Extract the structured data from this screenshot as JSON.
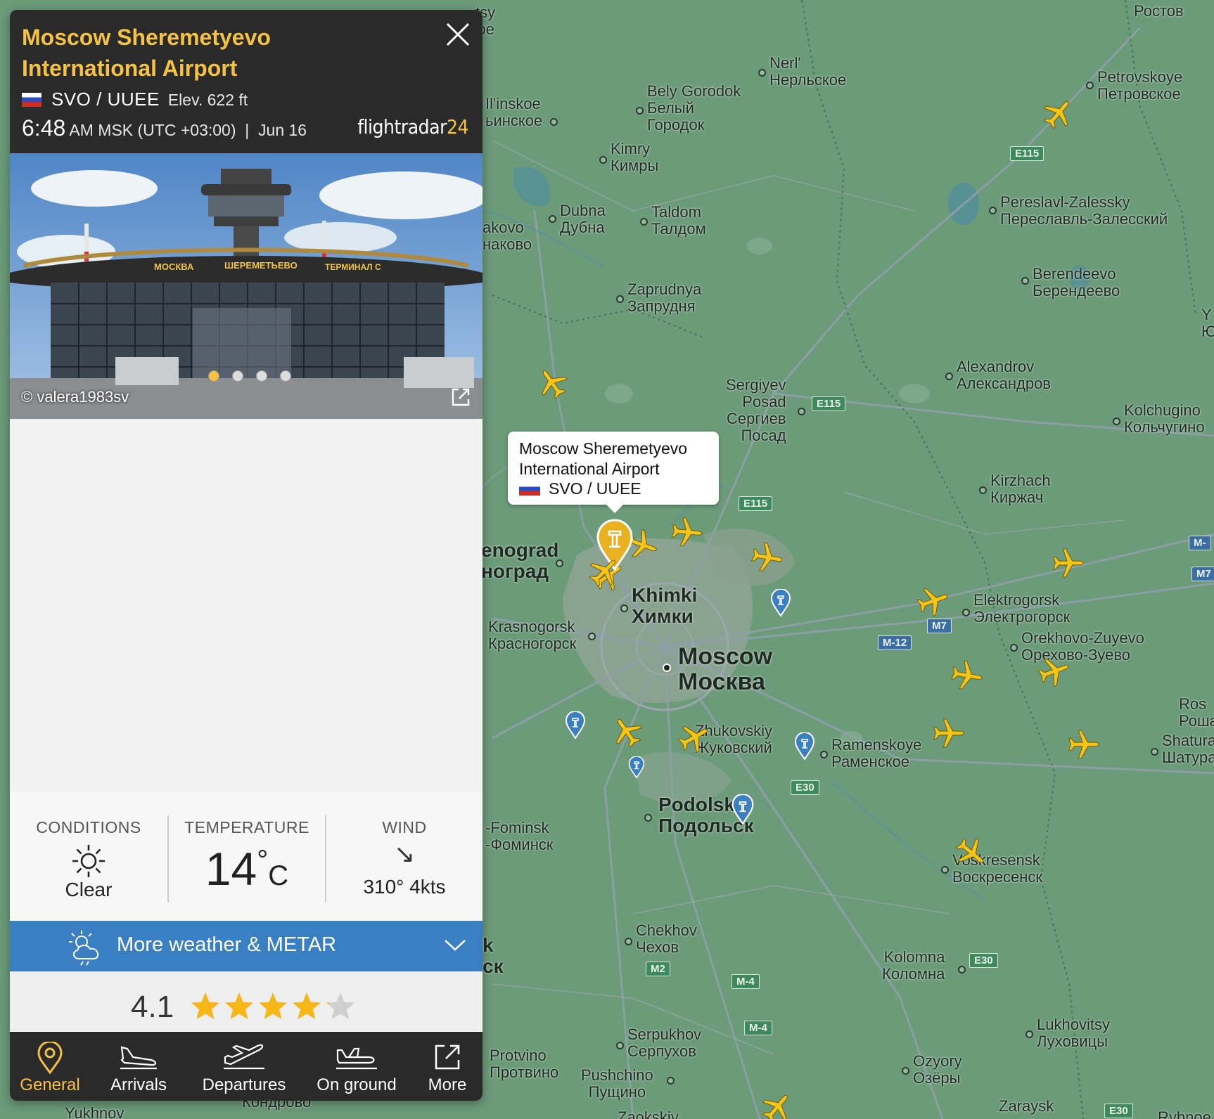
{
  "airport": {
    "name_line1": "Moscow Sheremetyevo",
    "name_line2": "International Airport",
    "codes": "SVO / UUEE",
    "elevation": "Elev. 622 ft",
    "time": "6:48",
    "time_suffix": "AM MSK (UTC +03:00)  |  Jun 16",
    "brand_main": "flightradar",
    "brand_num": "24"
  },
  "photo": {
    "credit": "© valera1983sv",
    "sign_left": "МОСКВА",
    "sign_mid": "ШЕРЕМЕТЬЕВО",
    "sign_right": "ТЕРМИНАЛ С",
    "slide_count": 4,
    "active_slide": 1
  },
  "weather": {
    "conditions_label": "CONDITIONS",
    "conditions_value": "Clear",
    "temperature_label": "TEMPERATURE",
    "temperature_value": "14",
    "temperature_deg": "°",
    "temperature_unit": "C",
    "wind_label": "WIND",
    "wind_arrow": "↘",
    "wind_value": "310° 4kts",
    "more_label": "More weather & METAR"
  },
  "rating": {
    "value": "4.1",
    "stars": 4.1,
    "max": 5
  },
  "nav": {
    "general": "General",
    "arrivals": "Arrivals",
    "departures": "Departures",
    "on_ground": "On ground",
    "more": "More"
  },
  "callout": {
    "line1": "Moscow Sheremetyevo",
    "line2": "International Airport",
    "codes": "SVO / UUEE"
  },
  "cities": {
    "rostov": "Ростов",
    "nerl_en": "Nerl'",
    "nerl_ru": "Нерльское",
    "petrovskoye_en": "Petrovskoye",
    "petrovskoye_ru": "Петровское",
    "bely_en1": "Bely Gorodok",
    "bely_ru1": "Белый",
    "bely_ru2": "Городок",
    "ilinskoe_en": "Il'inskoe",
    "ilinskoe_ru": "ьинское",
    "kimry_en": "Kimry",
    "kimry_ru": "Кимры",
    "dubna_en": "Dubna",
    "dubna_ru": "Дубна",
    "taldom_en": "Taldom",
    "taldom_ru": "Талдом",
    "pereslavl_en": "Pereslavl-Zalessky",
    "pereslavl_ru": "Переславль-Залесский",
    "nakovo_en": "akovo",
    "nakovo_ru": "наково",
    "berendeevo_en": "Berendeevo",
    "berendeevo_ru": "Берендеево",
    "zaprudnya_en": "Zaprudnya",
    "zaprudnya_ru": "Запрудня",
    "alexandrov_en": "Alexandrov",
    "alexandrov_ru": "Александров",
    "sergiyev_en1": "Sergiyev",
    "sergiyev_en2": "Posad",
    "sergiyev_ru1": "Сергиев",
    "sergiyev_ru2": "Посад",
    "kolchugino_en": "Kolchugino",
    "kolchugino_ru": "Кольчугино",
    "kirzhach_en": "Kirzhach",
    "kirzhach_ru": "Киржач",
    "zelenograd_en": "enograd",
    "zelenograd_ru": "ноград",
    "khimki_en": "Khimki",
    "khimki_ru": "Химки",
    "elektrogorsk_en": "Elektrogorsk",
    "elektrogorsk_ru": "Электрогорск",
    "krasnogorsk_en": "Krasnogorsk",
    "krasnogorsk_ru": "Красногорск",
    "orekhovo_en": "Orekhovo-Zuyevo",
    "orekhovo_ru": "Орехово-Зуево",
    "moscow_en": "Moscow",
    "moscow_ru": "Москва",
    "zhukovskiy_en": "Zhukovskiy",
    "zhukovskiy_ru": "Жуковский",
    "ramenskoye_en": "Ramenskoye",
    "ramenskoye_ru": "Раменское",
    "ros_en": "Ros",
    "ros_ru": "Роша",
    "shatura_en": "Shatura",
    "shatura_ru": "Шатура",
    "podolsk_en": "Podolsk",
    "podolsk_ru": "Подольск",
    "fominsk_en": "-Fominsk",
    "fominsk_ru": "-Фоминск",
    "voskresensk_en": "Voskresensk",
    "voskresensk_ru": "Воскресенск",
    "chekhov_en": "Chekhov",
    "chekhov_ru": "Чехов",
    "kolomna_en": "Kolomna",
    "kolomna_ru": "Коломна",
    "lukhovitsy_en": "Lukhovitsy",
    "lukhovitsy_ru": "Луховицы",
    "serpukhov_en": "Serpukhov",
    "serpukhov_ru": "Серпухов",
    "protvino_en": "Protvino",
    "protvino_ru": "Протвино",
    "pushchino_en": "Pushchino",
    "pushchino_ru": "Пущино",
    "ozyory_en": "Ozyory",
    "ozyory_ru": "Озёры",
    "zaraysk_en": "Zaraysk",
    "yukhnov_en": "Yukhnov",
    "kondrovo_ru": "Кондрово",
    "zaokskiy_en": "Zaokskiy",
    "rybnoe_en": "Rybnoe",
    "tsy_en": "tsy",
    "tskoe_ru": "цкое",
    "k_left": "k",
    "ck_left": "ск",
    "u_right": "Ю",
    "y_right": "Y"
  },
  "roads": {
    "e115a": "E115",
    "e115b": "E115",
    "e115c": "E115",
    "m7": "M7",
    "m12": "M-12",
    "e30a": "E30",
    "e30b": "E30",
    "e30c": "E30",
    "m2": "M2",
    "m4a": "M-4",
    "m4b": "M-4",
    "m_right1": "M-",
    "m_right2": "M7"
  },
  "colors": {
    "accent": "#f5c242",
    "panel_dark": "#2a2a2a",
    "metar_blue": "#3a7fc1",
    "map_green": "#6a9a78"
  }
}
